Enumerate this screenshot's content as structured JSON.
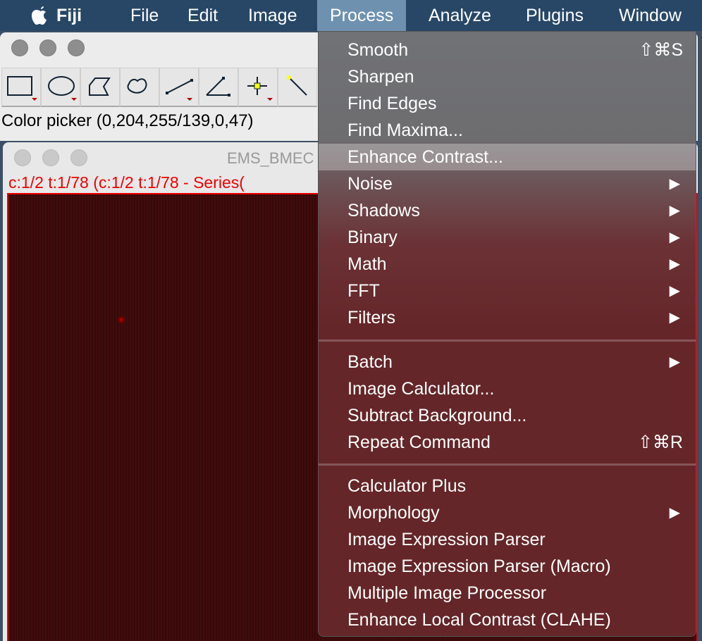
{
  "menubar": {
    "apple_icon": "apple-logo",
    "items": [
      "Fiji",
      "File",
      "Edit",
      "Image",
      "Process",
      "Analyze",
      "Plugins",
      "Window"
    ],
    "active": "Process"
  },
  "toolbar": {
    "tools": [
      "rectangle",
      "oval",
      "polygon",
      "freehand",
      "line",
      "angle",
      "point",
      "wand"
    ],
    "status": "Color picker (0,204,255/139,0,47)"
  },
  "image_window": {
    "title": "EMS_BMEC",
    "subtitle": "c:1/2 t:1/78 (c:1/2 t:1/78 - Series("
  },
  "menu": {
    "group1": [
      {
        "label": "Smooth",
        "shortcut": "⇧⌘S"
      },
      {
        "label": "Sharpen"
      },
      {
        "label": "Find Edges"
      },
      {
        "label": "Find Maxima..."
      },
      {
        "label": "Enhance Contrast...",
        "highlighted": true
      },
      {
        "label": "Noise",
        "submenu": true
      },
      {
        "label": "Shadows",
        "submenu": true
      },
      {
        "label": "Binary",
        "submenu": true
      },
      {
        "label": "Math",
        "submenu": true
      },
      {
        "label": "FFT",
        "submenu": true
      },
      {
        "label": "Filters",
        "submenu": true
      }
    ],
    "group2": [
      {
        "label": "Batch",
        "submenu": true
      },
      {
        "label": "Image Calculator..."
      },
      {
        "label": "Subtract Background..."
      },
      {
        "label": "Repeat Command",
        "shortcut": "⇧⌘R"
      }
    ],
    "group3": [
      {
        "label": "Calculator Plus"
      },
      {
        "label": "Morphology",
        "submenu": true
      },
      {
        "label": "Image Expression Parser"
      },
      {
        "label": "Image Expression Parser (Macro)"
      },
      {
        "label": "Multiple Image Processor"
      },
      {
        "label": "Enhance Local Contrast (CLAHE)"
      }
    ],
    "submenu_arrow": "▶"
  },
  "colors": {
    "menubar": "#284766",
    "active": "#6e91b0",
    "status_red": "#e00000"
  }
}
